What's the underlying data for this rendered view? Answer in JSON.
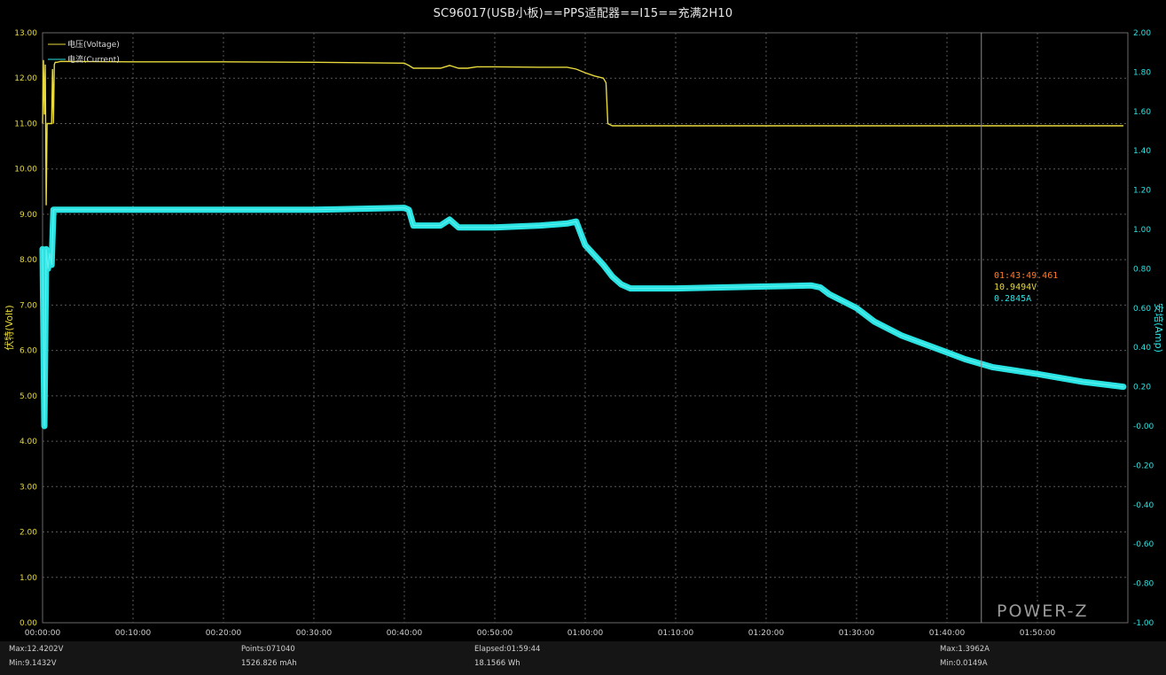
{
  "title": "SC96017(USB小板)==PPS适配器==I15==充满2H10",
  "colors": {
    "voltage": "#e8d93c",
    "current": "#29e3e3",
    "grid": "#5a5a5a",
    "cursor_time": "#ff7a2a",
    "background": "#000000"
  },
  "brand": "POWER-Z",
  "cursor": {
    "time": "01:43:49.461",
    "voltage": "10.9494V",
    "current": "0.2845A"
  },
  "footer": {
    "max_v": "Max:12.4202V",
    "min_v": "Min:9.1432V",
    "points": "Points:071040",
    "capacity": "1526.826 mAh",
    "elapsed": "Elapsed:01:59:44",
    "energy": "18.1566 Wh",
    "max_a": "Max:1.3962A",
    "min_a": "Min:0.0149A"
  },
  "chart_data": {
    "type": "line",
    "title": "SC96017(USB小板)==PPS适配器==I15==充满2H10",
    "xlabel": "",
    "ylabel": "伏特(Volt)",
    "y2label": "安培(Amp)",
    "x_unit": "minutes",
    "xlim": [
      0,
      120
    ],
    "ylim": [
      0,
      13
    ],
    "y2lim": [
      -1,
      2
    ],
    "x_ticks": [
      "00:00:00",
      "00:10:00",
      "00:20:00",
      "00:30:00",
      "00:40:00",
      "00:50:00",
      "01:00:00",
      "01:10:00",
      "01:20:00",
      "01:30:00",
      "01:40:00",
      "01:50:00"
    ],
    "y_ticks": [
      "0.00",
      "1.00",
      "2.00",
      "3.00",
      "4.00",
      "5.00",
      "6.00",
      "7.00",
      "8.00",
      "9.00",
      "10.00",
      "11.00",
      "12.00",
      "13.00"
    ],
    "y2_ticks": [
      "-1.00",
      "-0.80",
      "-0.60",
      "-0.40",
      "-0.20",
      "-0.00",
      "0.20",
      "0.40",
      "0.60",
      "0.80",
      "1.00",
      "1.20",
      "1.40",
      "1.60",
      "1.80",
      "2.00"
    ],
    "grid": true,
    "legend_position": "top-left",
    "cursor_x": 103.8,
    "series": [
      {
        "name": "电压(Voltage)",
        "axis": "left",
        "x": [
          0,
          0.1,
          0.2,
          0.3,
          0.4,
          0.5,
          1.0,
          1.1,
          1.2,
          1.3,
          1.4,
          1.5,
          1.6,
          2.0,
          10,
          20,
          30,
          40,
          40.5,
          41,
          44,
          45,
          46,
          47,
          48,
          50,
          55,
          58,
          59,
          60,
          61,
          62,
          62.3,
          62.5,
          63,
          70,
          80,
          90,
          100,
          110,
          119.5
        ],
        "y": [
          11.0,
          12.4,
          11.2,
          12.3,
          9.2,
          11.0,
          11.0,
          12.2,
          11.0,
          12.3,
          12.35,
          12.35,
          12.35,
          12.37,
          12.36,
          12.36,
          12.35,
          12.33,
          12.28,
          12.22,
          12.22,
          12.28,
          12.22,
          12.22,
          12.25,
          12.25,
          12.24,
          12.24,
          12.2,
          12.12,
          12.05,
          12.0,
          11.9,
          11.0,
          10.95,
          10.95,
          10.95,
          10.95,
          10.95,
          10.95,
          10.95
        ]
      },
      {
        "name": "电流(Current)",
        "axis": "right",
        "x": [
          0,
          0.2,
          0.4,
          0.6,
          0.8,
          1.0,
          1.2,
          1.5,
          2.0,
          10,
          20,
          30,
          40,
          40.5,
          41,
          44,
          45,
          46,
          50,
          55,
          58,
          59,
          60,
          62,
          63,
          64,
          65,
          70,
          75,
          80,
          85,
          86,
          87,
          90,
          92,
          95,
          100,
          102,
          105,
          110,
          115,
          119.5
        ],
        "y": [
          0.9,
          0.0,
          0.9,
          0.8,
          0.88,
          0.82,
          1.1,
          1.1,
          1.1,
          1.1,
          1.1,
          1.1,
          1.11,
          1.1,
          1.02,
          1.02,
          1.05,
          1.01,
          1.01,
          1.02,
          1.03,
          1.04,
          0.92,
          0.82,
          0.76,
          0.72,
          0.7,
          0.7,
          0.705,
          0.71,
          0.715,
          0.705,
          0.67,
          0.6,
          0.53,
          0.46,
          0.375,
          0.34,
          0.3,
          0.265,
          0.225,
          0.2
        ]
      }
    ]
  }
}
